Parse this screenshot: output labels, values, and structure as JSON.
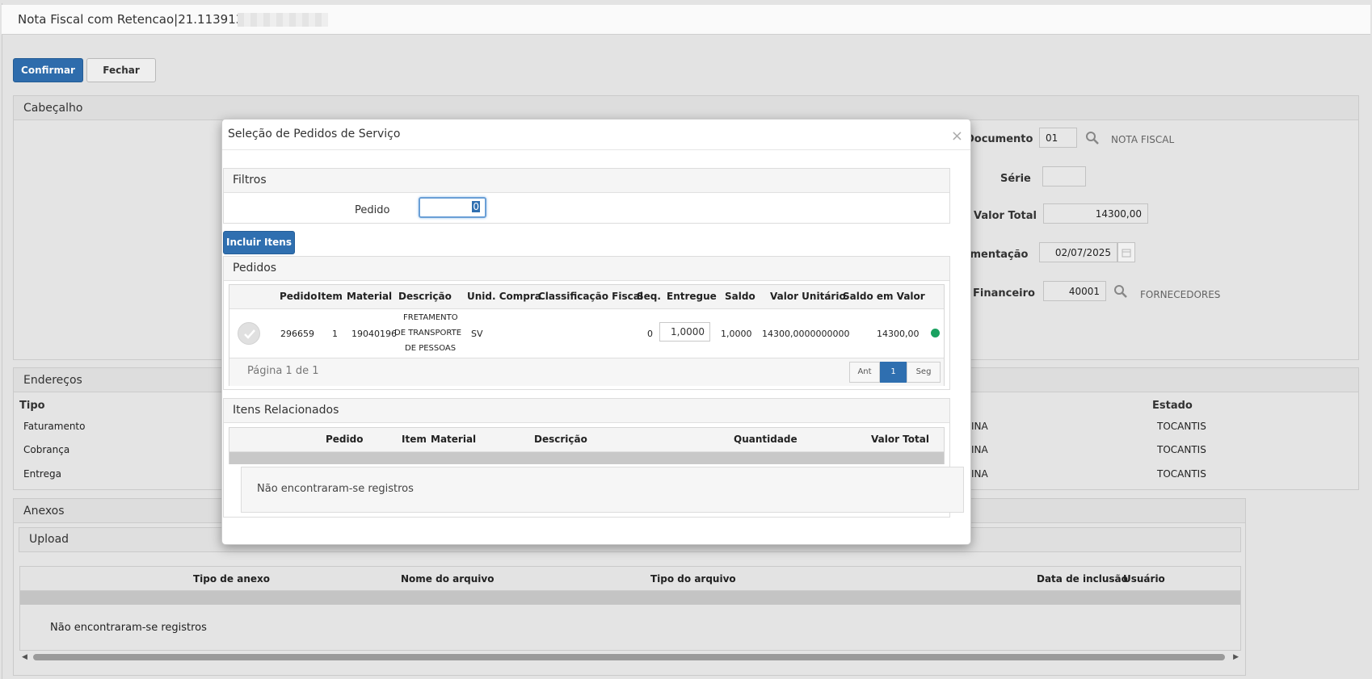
{
  "window": {
    "title": "Nota Fiscal com Retencao|21.113913|"
  },
  "toolbar": {
    "confirm_label": "Confirmar",
    "close_label": "Fechar"
  },
  "cabecalho": {
    "title": "Cabeçalho",
    "documento_label": "Documento",
    "documento_value": "01",
    "documento_desc": "NOTA FISCAL",
    "serie_label": "Série",
    "serie_value": "",
    "valor_total_label": "Valor Total",
    "valor_total_value": "14300,00",
    "movimentacao_label": "imentação",
    "movimentacao_value": "02/07/2025",
    "financeiro_label": "Financeiro",
    "financeiro_value": "40001",
    "financeiro_desc": "FORNECEDORES"
  },
  "enderecos": {
    "title": "Endereços",
    "col_tipo": "Tipo",
    "col_estado": "Estado",
    "rows": [
      {
        "tipo": "Faturamento",
        "cidade": "INA",
        "estado": "TOCANTIS"
      },
      {
        "tipo": "Cobrança",
        "cidade": "INA",
        "estado": "TOCANTIS"
      },
      {
        "tipo": "Entrega",
        "cidade": "INA",
        "estado": "TOCANTIS"
      }
    ]
  },
  "anexos": {
    "title": "Anexos",
    "upload_label": "Upload",
    "columns": [
      "Tipo de anexo",
      "Nome do arquivo",
      "Tipo do arquivo",
      "Data de inclusão",
      "Usuário"
    ],
    "empty_text": "Não encontraram-se registros"
  },
  "modal": {
    "title": "Seleção de Pedidos de Serviço",
    "close_symbol": "×",
    "filtros_title": "Filtros",
    "pedido_label": "Pedido",
    "pedido_value": "0",
    "incluir_label": "Incluir Itens",
    "pedidos_title": "Pedidos",
    "pedidos_columns": [
      "Pedido",
      "Item",
      "Material",
      "Descrição",
      "Unid. Compra",
      "Classificação Fiscal",
      "Seq.",
      "Entregue",
      "Saldo",
      "Valor Unitário",
      "Saldo em Valor"
    ],
    "pedido_row": {
      "pedido": "296659",
      "item": "1",
      "material": "19040196",
      "descricao_1": "FRETAMENTO",
      "descricao_2": "DE TRANSPORTE",
      "descricao_3": "DE PESSOAS",
      "unid": "SV",
      "seq": "0",
      "entregue": "1,0000",
      "saldo": "1,0000",
      "valor_unitario": "14300,0000000000",
      "saldo_valor": "14300,00",
      "status_color": "#1aa160"
    },
    "pagination_text": "Página 1 de 1",
    "pager": {
      "prev": "Ant",
      "current": "1",
      "next": "Seg"
    },
    "itens_title": "Itens Relacionados",
    "itens_columns": [
      "Pedido",
      "Item",
      "Material",
      "Descrição",
      "Quantidade",
      "Valor Total"
    ],
    "itens_empty": "Não encontraram-se registros"
  },
  "colors": {
    "primary": "#2f6fb0",
    "status_green": "#1aa160"
  }
}
